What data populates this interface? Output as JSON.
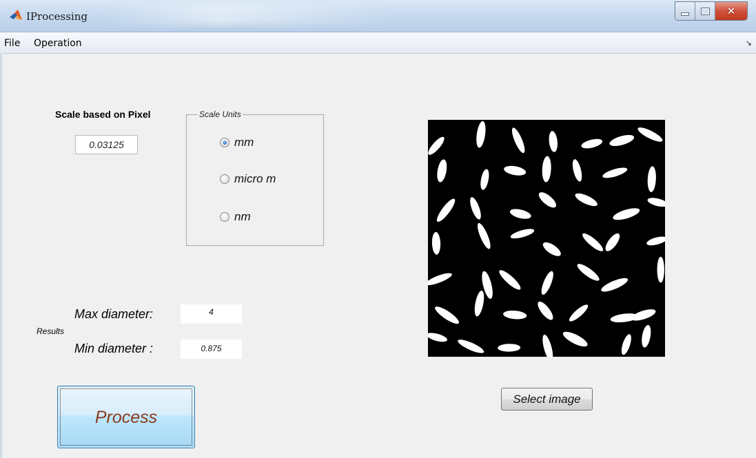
{
  "window": {
    "title": "IProcessing"
  },
  "menu": [
    {
      "label": "File"
    },
    {
      "label": "Operation"
    }
  ],
  "scale": {
    "title": "Scale based on Pixel",
    "value": "0.03125"
  },
  "units_panel": {
    "title": "Scale Units",
    "options": [
      {
        "label": "mm",
        "selected": true
      },
      {
        "label": "micro m",
        "selected": false
      },
      {
        "label": "nm",
        "selected": false
      }
    ]
  },
  "results": {
    "label": "Results",
    "max_label": "Max diameter:",
    "max_value": "4",
    "min_label": "Min diameter :",
    "min_value": "0.875"
  },
  "process_button": "Process",
  "select_button": "Select image",
  "icons": {
    "app": "matlab-icon",
    "minimize": "minimize-icon",
    "maximize": "maximize-icon",
    "close": "close-icon",
    "dock": "dock-arrow-icon"
  },
  "colors": {
    "process_text": "#8a3a1c",
    "radio_selected": "#2a6fc2",
    "image_bg": "#000000",
    "grain": "#ffffff"
  }
}
